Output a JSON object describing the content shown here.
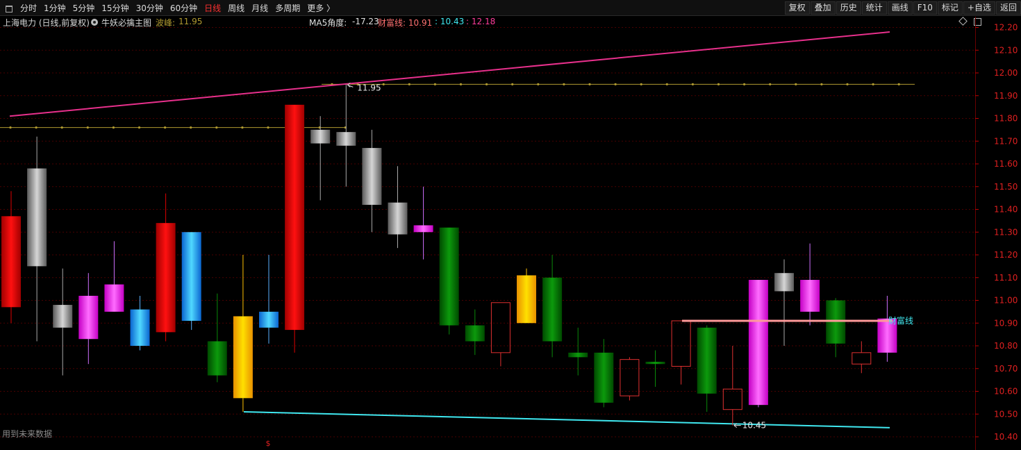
{
  "toolbar": {
    "periods": [
      "分时",
      "1分钟",
      "5分钟",
      "15分钟",
      "30分钟",
      "60分钟",
      "日线",
      "周线",
      "月线",
      "多周期",
      "更多 〉"
    ],
    "active_period": "日线",
    "tools": [
      "复权",
      "叠加",
      "历史",
      "统计",
      "画线",
      "F10",
      "标记",
      "+自选",
      "返回"
    ]
  },
  "info": {
    "stock": "上海电力 (日线,前复权)",
    "indicator": "牛妖必擒主图",
    "wave_peak_label": "波峰: ",
    "wave_peak_value": "11.95",
    "ma5_label": "MA5角度: ",
    "ma5_value": "-17.23",
    "wealth_text": "财富线: 10.91",
    "cyan_text": ": 10.43",
    "pink_text": ": 12.18"
  },
  "annotations": {
    "high_label": "11.95",
    "low_label": "10.45",
    "wealth_line_label": "财富线",
    "future_data": "用到未来数据",
    "s_marker": "$"
  },
  "colors": {
    "background": "#000000",
    "red": "#e00000",
    "gray": "#9a9a9a",
    "magenta": "#ff2cff",
    "blue": "#1e90ff",
    "green": "#007a00",
    "gold": "#ffc000",
    "hollow_red": "#e03030",
    "pink_trend": "#e8308c",
    "cyan_trend": "#40e8f0",
    "olive_level": "#b09a30",
    "wealth_line": "#ff9a9a"
  },
  "chart_data": {
    "type": "candlestick",
    "y_ticks": [
      "12.20",
      "12.10",
      "12.00",
      "11.90",
      "11.80",
      "11.70",
      "11.60",
      "11.50",
      "11.40",
      "11.30",
      "11.20",
      "11.10",
      "11.00",
      "10.90",
      "10.80",
      "10.70",
      "10.60",
      "10.50",
      "10.40"
    ],
    "ylim": [
      10.37,
      12.25
    ],
    "grid": true,
    "candles": [
      {
        "o": 10.97,
        "h": 11.48,
        "l": 10.9,
        "c": 11.37,
        "style": "red"
      },
      {
        "o": 11.15,
        "h": 11.72,
        "l": 10.82,
        "c": 11.58,
        "style": "gray"
      },
      {
        "o": 10.88,
        "h": 11.14,
        "l": 10.67,
        "c": 10.98,
        "style": "gray"
      },
      {
        "o": 10.83,
        "h": 11.12,
        "l": 10.72,
        "c": 11.02,
        "style": "magenta"
      },
      {
        "o": 10.95,
        "h": 11.26,
        "l": 10.95,
        "c": 11.07,
        "style": "magenta"
      },
      {
        "o": 10.8,
        "h": 11.02,
        "l": 10.78,
        "c": 10.96,
        "style": "blue"
      },
      {
        "o": 10.86,
        "h": 11.47,
        "l": 10.82,
        "c": 11.34,
        "style": "red"
      },
      {
        "o": 10.91,
        "h": 11.3,
        "l": 10.87,
        "c": 11.3,
        "style": "blue"
      },
      {
        "o": 10.82,
        "h": 11.03,
        "l": 10.64,
        "c": 10.67,
        "style": "green"
      },
      {
        "o": 10.57,
        "h": 11.2,
        "l": 10.51,
        "c": 10.93,
        "style": "gold"
      },
      {
        "o": 10.88,
        "h": 11.2,
        "l": 10.81,
        "c": 10.95,
        "style": "blue"
      },
      {
        "o": 10.87,
        "h": 11.86,
        "l": 10.77,
        "c": 11.86,
        "style": "red"
      },
      {
        "o": 11.69,
        "h": 11.81,
        "l": 11.44,
        "c": 11.75,
        "style": "gray"
      },
      {
        "o": 11.68,
        "h": 11.95,
        "l": 11.5,
        "c": 11.74,
        "style": "gray"
      },
      {
        "o": 11.42,
        "h": 11.75,
        "l": 11.3,
        "c": 11.67,
        "style": "gray"
      },
      {
        "o": 11.29,
        "h": 11.59,
        "l": 11.23,
        "c": 11.43,
        "style": "gray"
      },
      {
        "o": 11.3,
        "h": 11.5,
        "l": 11.18,
        "c": 11.33,
        "style": "magenta"
      },
      {
        "o": 11.32,
        "h": 11.32,
        "l": 10.85,
        "c": 10.89,
        "style": "green"
      },
      {
        "o": 10.89,
        "h": 10.96,
        "l": 10.76,
        "c": 10.82,
        "style": "green"
      },
      {
        "o": 10.77,
        "h": 10.99,
        "l": 10.71,
        "c": 10.99,
        "style": "hollow"
      },
      {
        "o": 10.9,
        "h": 11.14,
        "l": 10.9,
        "c": 11.11,
        "style": "gold"
      },
      {
        "o": 11.1,
        "h": 11.2,
        "l": 10.75,
        "c": 10.82,
        "style": "green"
      },
      {
        "o": 10.77,
        "h": 10.88,
        "l": 10.67,
        "c": 10.75,
        "style": "green"
      },
      {
        "o": 10.77,
        "h": 10.83,
        "l": 10.53,
        "c": 10.55,
        "style": "green"
      },
      {
        "o": 10.58,
        "h": 10.75,
        "l": 10.56,
        "c": 10.74,
        "style": "hollow"
      },
      {
        "o": 10.73,
        "h": 10.78,
        "l": 10.62,
        "c": 10.72,
        "style": "green"
      },
      {
        "o": 10.71,
        "h": 10.91,
        "l": 10.63,
        "c": 10.91,
        "style": "hollow"
      },
      {
        "o": 10.88,
        "h": 10.89,
        "l": 10.51,
        "c": 10.59,
        "style": "green"
      },
      {
        "o": 10.52,
        "h": 10.8,
        "l": 10.45,
        "c": 10.61,
        "style": "hollow"
      },
      {
        "o": 10.54,
        "h": 11.09,
        "l": 10.53,
        "c": 11.09,
        "style": "magenta"
      },
      {
        "o": 11.04,
        "h": 11.18,
        "l": 10.8,
        "c": 11.12,
        "style": "gray"
      },
      {
        "o": 10.95,
        "h": 11.25,
        "l": 10.89,
        "c": 11.09,
        "style": "magenta"
      },
      {
        "o": 11.0,
        "h": 11.01,
        "l": 10.75,
        "c": 10.81,
        "style": "green"
      },
      {
        "o": 10.72,
        "h": 10.82,
        "l": 10.68,
        "c": 10.77,
        "style": "hollow"
      },
      {
        "o": 10.77,
        "h": 11.02,
        "l": 10.73,
        "c": 10.92,
        "style": "magenta"
      }
    ],
    "pink_trendline": {
      "start": 11.81,
      "end": 12.18
    },
    "cyan_trendline": {
      "start": 10.51,
      "end": 10.44
    },
    "olive_level_1": 11.76,
    "olive_level_2": 11.95,
    "wealth_line": 10.91
  }
}
